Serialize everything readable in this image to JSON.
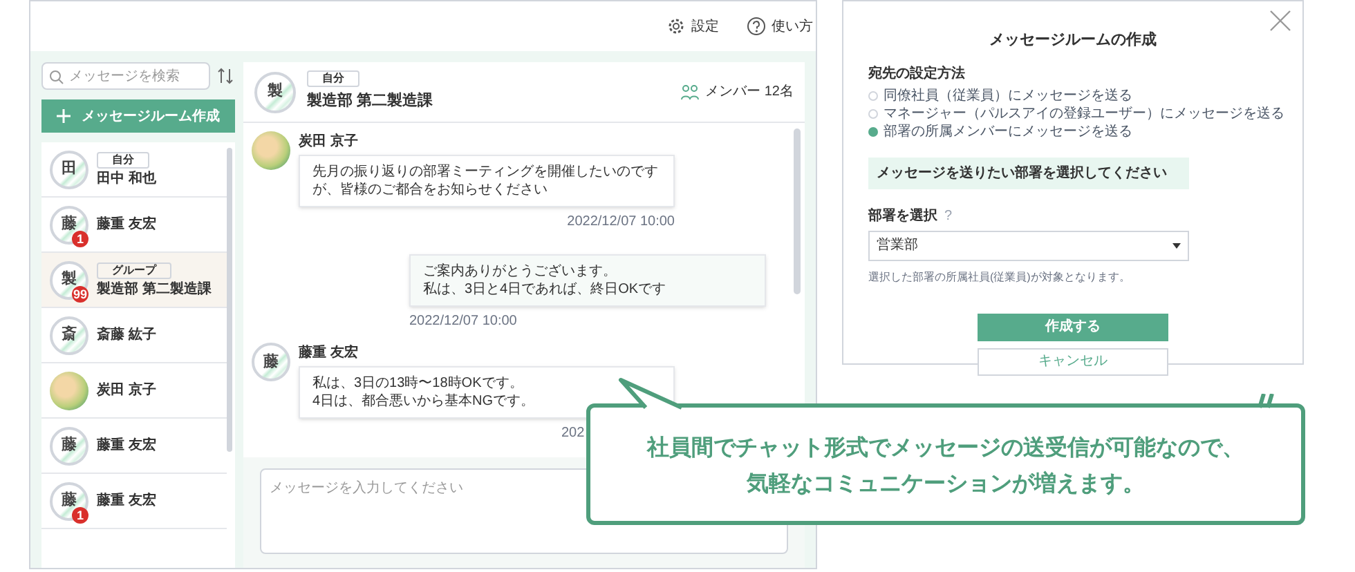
{
  "topbar": {
    "items": [
      {
        "label": "設定"
      },
      {
        "label": "使い方"
      }
    ]
  },
  "sidebar": {
    "search": {
      "placeholder": "メッセージを検索"
    },
    "create_button": {
      "label": "メッセージルーム作成"
    },
    "rooms": [
      {
        "kind": "initial",
        "avatar": "田",
        "tag": "自分",
        "name": "田中 和也",
        "selected": false
      },
      {
        "kind": "initial",
        "avatar": "藤",
        "name": "藤重 友宏",
        "badge": "1",
        "selected": false
      },
      {
        "kind": "initial",
        "avatar": "製",
        "tag": "グループ",
        "name": "製造部 第二製造課",
        "badge": "99",
        "selected": true
      },
      {
        "kind": "initial",
        "avatar": "斎",
        "name": "斎藤 紘子",
        "selected": false
      },
      {
        "kind": "photo",
        "name": "炭田 京子",
        "selected": false
      },
      {
        "kind": "initial",
        "avatar": "藤",
        "name": "藤重 友宏",
        "selected": false
      },
      {
        "kind": "initial",
        "avatar": "藤",
        "name": "藤重 友宏",
        "badge": "1",
        "selected": false
      }
    ]
  },
  "chat": {
    "header": {
      "avatar": "製",
      "tag": "自分",
      "title": "製造部 第二製造課",
      "members": "メンバー 12名"
    },
    "messages": [
      {
        "kind": "incoming",
        "sender": "炭田 京子",
        "lines": [
          "先月の振り返りの部署ミーティングを開催したいのですが、皆様のご都合をお知らせください"
        ],
        "time": "2022/12/07 10:00"
      },
      {
        "kind": "outgoing",
        "lines": [
          "ご案内ありがとうございます。",
          "私は、3日と4日であれば、終日OKです"
        ],
        "time": "2022/12/07 10:00"
      },
      {
        "kind": "incoming",
        "avatar": "藤",
        "sender": "藤重 友宏",
        "lines": [
          "私は、3日の13時〜18時OKです。",
          "4日は、都合悪いから基本NGです。"
        ],
        "time": "202"
      }
    ],
    "input": {
      "placeholder": "メッセージを入力してください"
    }
  },
  "modal": {
    "title": "メッセージルームの作成",
    "destination": {
      "label": "宛先の設定方法",
      "options": [
        {
          "label": "同僚社員（従業員）にメッセージを送る",
          "selected": false
        },
        {
          "label": "マネージャー（パルスアイの登録ユーザー）にメッセージを送る",
          "selected": false
        },
        {
          "label": "部署の所属メンバーにメッセージを送る",
          "selected": true
        }
      ]
    },
    "notice": "メッセージを送りたい部署を選択してください",
    "department": {
      "label": "部署を選択",
      "help": "?",
      "value": "営業部"
    },
    "note": "選択した部署の所属社員(従業員)が対象となります。",
    "buttons": [
      {
        "kind": "primary",
        "label": "作成する"
      },
      {
        "kind": "secondary",
        "label": "キャンセル"
      }
    ]
  },
  "callout": {
    "lines": [
      "社員間でチャット形式でメッセージの送受信が可能なので、",
      "気軽なコミュニケーションが増えます。"
    ]
  }
}
